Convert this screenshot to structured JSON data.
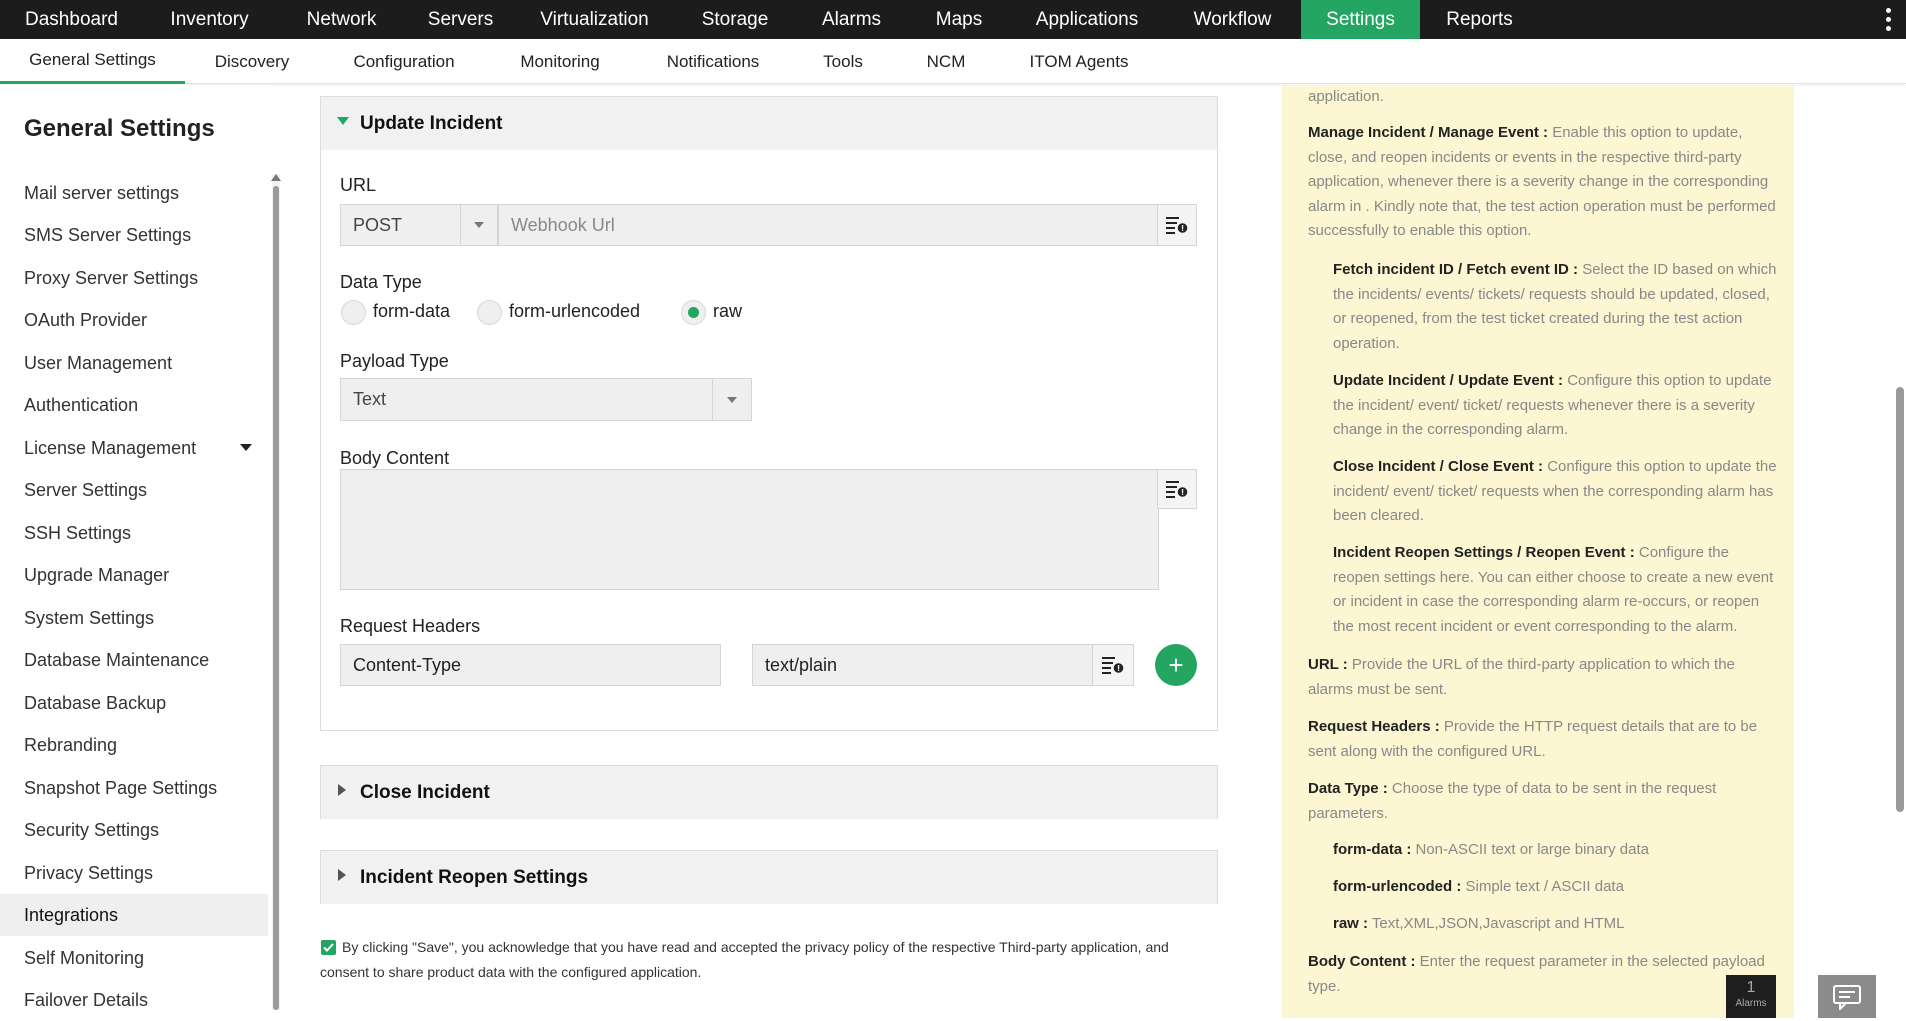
{
  "top_nav": {
    "items": [
      {
        "label": "Dashboard"
      },
      {
        "label": "Inventory"
      },
      {
        "label": "Network"
      },
      {
        "label": "Servers"
      },
      {
        "label": "Virtualization"
      },
      {
        "label": "Storage"
      },
      {
        "label": "Alarms"
      },
      {
        "label": "Maps"
      },
      {
        "label": "Applications"
      },
      {
        "label": "Workflow"
      },
      {
        "label": "Settings",
        "active": true
      },
      {
        "label": "Reports"
      }
    ]
  },
  "sub_nav": {
    "items": [
      {
        "label": "General Settings",
        "active": true
      },
      {
        "label": "Discovery"
      },
      {
        "label": "Configuration"
      },
      {
        "label": "Monitoring"
      },
      {
        "label": "Notifications"
      },
      {
        "label": "Tools"
      },
      {
        "label": "NCM"
      },
      {
        "label": "ITOM Agents"
      }
    ]
  },
  "sidebar": {
    "title": "General Settings",
    "items": [
      {
        "label": "Mail server settings"
      },
      {
        "label": "SMS Server Settings"
      },
      {
        "label": "Proxy Server Settings"
      },
      {
        "label": "OAuth Provider"
      },
      {
        "label": "User Management"
      },
      {
        "label": "Authentication"
      },
      {
        "label": "License Management",
        "expandable": true
      },
      {
        "label": "Server Settings"
      },
      {
        "label": "SSH Settings"
      },
      {
        "label": "Upgrade Manager"
      },
      {
        "label": "System Settings"
      },
      {
        "label": "Database Maintenance"
      },
      {
        "label": "Database Backup"
      },
      {
        "label": "Rebranding"
      },
      {
        "label": "Snapshot Page Settings"
      },
      {
        "label": "Security Settings"
      },
      {
        "label": "Privacy Settings"
      },
      {
        "label": "Integrations",
        "active": true
      },
      {
        "label": "Self Monitoring"
      },
      {
        "label": "Failover Details"
      }
    ]
  },
  "update_incident": {
    "title": "Update Incident",
    "url_label": "URL",
    "method": "POST",
    "url_placeholder": "Webhook Url",
    "data_type_label": "Data Type",
    "data_types": [
      {
        "label": "form-data",
        "checked": false
      },
      {
        "label": "form-urlencoded",
        "checked": false
      },
      {
        "label": "raw",
        "checked": true
      }
    ],
    "payload_type_label": "Payload Type",
    "payload_type": "Text",
    "body_content_label": "Body Content",
    "body_content": "",
    "request_headers_label": "Request Headers",
    "header_name": "Content-Type",
    "header_value": "text/plain",
    "add_symbol": "+"
  },
  "close_incident": {
    "title": "Close Incident"
  },
  "incident_reopen": {
    "title": "Incident Reopen Settings"
  },
  "consent": {
    "checked": true,
    "text": "By clicking \"Save\", you acknowledge that you have read and accepted the privacy policy of the respective Third-party application, and consent to share product data with the configured application."
  },
  "help": {
    "intro_tail": "application.",
    "manage_title": "Manage Incident / Manage Event :",
    "manage_text": " Enable this option to update, close, and reopen incidents or events in the respective third-party application, whenever there is a severity change in the corresponding alarm in . Kindly note that, the test action operation must be performed successfully to enable this option.",
    "fetch_title": "Fetch incident ID / Fetch event ID :",
    "fetch_text": " Select the ID based on which the incidents/ events/ tickets/ requests should be updated, closed, or reopened, from the test ticket created during the test action operation.",
    "update_title": "Update Incident / Update Event :",
    "update_text": " Configure this option to update the incident/ event/ ticket/ requests whenever there is a severity change in the corresponding alarm.",
    "close_title": "Close Incident / Close Event :",
    "close_text": " Configure this option to update the incident/ event/ ticket/ requests when the corresponding alarm has been cleared.",
    "reopen_title": "Incident Reopen Settings / Reopen Event :",
    "reopen_text": " Configure the reopen settings here. You can either choose to create a new event or incident in case the corresponding alarm re-occurs, or reopen the most recent incident or event corresponding to the alarm.",
    "url_title": "URL :",
    "url_text": "  Provide the URL of the third-party application to which the alarms must be sent.",
    "headers_title": "Request Headers :",
    "headers_text": "  Provide the HTTP request details that are to be sent along with the configured URL.",
    "datatype_title": "Data Type :",
    "datatype_text": " Choose the type of data to be sent in the request parameters.",
    "formdata_title": "form-data :",
    "formdata_text": " Non-ASCII text or large binary data",
    "urlenc_title": "form-urlencoded :",
    "urlenc_text": " Simple text / ASCII data",
    "raw_title": "raw :",
    "raw_text": " Text,XML,JSON,Javascript and HTML",
    "body_title": "Body Content :",
    "body_text": " Enter the request parameter in the selected payload type."
  },
  "alarm_badge": {
    "count": "1",
    "label": "Alarms"
  },
  "colors": {
    "accent": "#25a562",
    "topbar": "#1c1c1c",
    "help_bg": "#fcf6d2"
  }
}
